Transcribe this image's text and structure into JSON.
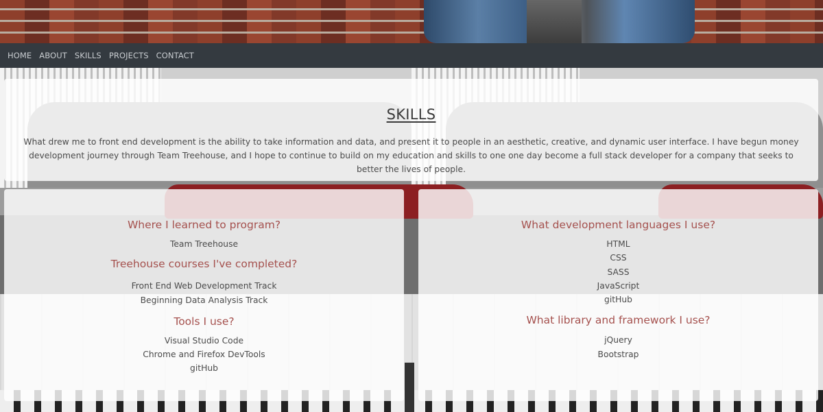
{
  "nav": {
    "items": [
      "HOME",
      "ABOUT",
      "SKILLS",
      "PROJECTS",
      "CONTACT"
    ]
  },
  "skills": {
    "title": "SKILLS",
    "text": "What drew me to front end development is the ability to take information and data, and present it to people in an aesthetic, creative, and dynamic user interface. I have begun money development journey through Team Treehouse, and I hope to continue to build on my education and skills to one one day become a full stack developer for a company that seeks to better the lives of people."
  },
  "left_column": {
    "learned_heading": "Where I learned to program?",
    "learned_items": [
      "Team Treehouse"
    ],
    "courses_heading": "Treehouse courses I've completed?",
    "courses_items": [
      "Front End Web Development Track",
      "Beginning Data Analysis Track"
    ],
    "tools_heading": "Tools I use?",
    "tools_items": [
      "Visual Studio Code",
      "Chrome and Firefox DevTools",
      "gitHub"
    ]
  },
  "right_column": {
    "languages_heading": "What development languages I use?",
    "languages_items": [
      "HTML",
      "CSS",
      "SASS",
      "JavaScript",
      "gitHub"
    ],
    "libraries_heading": "What library and framework I use?",
    "libraries_items": [
      "jQuery",
      "Bootstrap"
    ]
  },
  "colors": {
    "navbar": "#343a40",
    "heading_accent": "#a5514e",
    "text": "#4a4a4a"
  }
}
